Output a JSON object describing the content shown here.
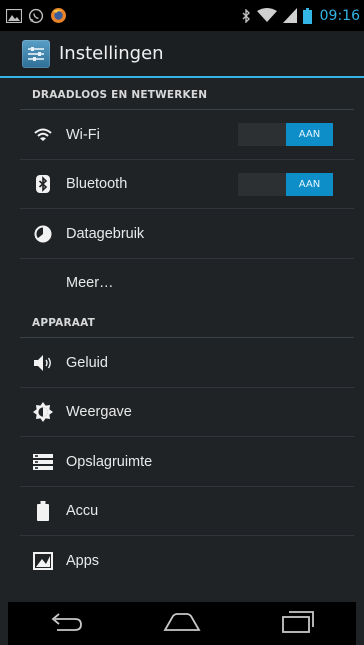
{
  "status_bar": {
    "time": "09:16",
    "left_icons": [
      "gallery-icon",
      "whatsapp-icon",
      "firefox-icon"
    ],
    "right_icons": [
      "bluetooth-icon",
      "wifi-icon",
      "signal-icon",
      "battery-icon"
    ]
  },
  "action_bar": {
    "title": "Instellingen",
    "icon": "settings-app-icon"
  },
  "sections": [
    {
      "header": "DRAADLOOS EN NETWERKEN",
      "items": [
        {
          "label": "Wi-Fi",
          "icon": "wifi-icon",
          "toggle": "AAN"
        },
        {
          "label": "Bluetooth",
          "icon": "bluetooth-icon",
          "toggle": "AAN"
        },
        {
          "label": "Datagebruik",
          "icon": "data-usage-icon"
        },
        {
          "label": "Meer…"
        }
      ]
    },
    {
      "header": "APPARAAT",
      "items": [
        {
          "label": "Geluid",
          "icon": "sound-icon"
        },
        {
          "label": "Weergave",
          "icon": "display-icon"
        },
        {
          "label": "Opslagruimte",
          "icon": "storage-icon"
        },
        {
          "label": "Accu",
          "icon": "battery-icon"
        },
        {
          "label": "Apps",
          "icon": "apps-icon"
        }
      ]
    }
  ],
  "nav_bar": {
    "buttons": [
      "back-icon",
      "home-icon",
      "recents-icon"
    ]
  },
  "colors": {
    "accent": "#33b5e5",
    "toggle_on": "#0d8ec9",
    "background": "#1f2326",
    "status_bar": "#000000"
  }
}
